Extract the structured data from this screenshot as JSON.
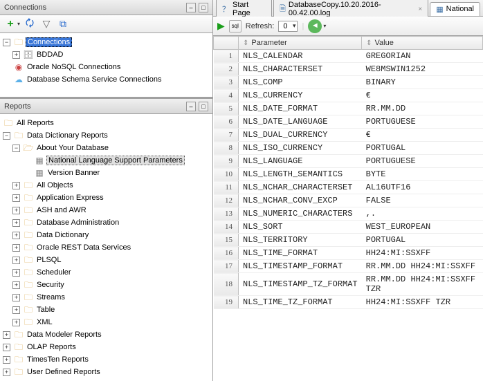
{
  "connections": {
    "title": "Connections",
    "toolbar": {
      "add": "+",
      "refresh": "↻",
      "filter": "▽",
      "layout": "⧉"
    },
    "rootLabel": "Connections",
    "items": [
      {
        "label": "BDDAD",
        "icon": "db"
      },
      {
        "label": "Oracle NoSQL Connections",
        "icon": "nosql"
      },
      {
        "label": "Database Schema Service Connections",
        "icon": "cloud"
      }
    ]
  },
  "reports": {
    "title": "Reports",
    "rootLabel": "All Reports",
    "dataDict": "Data Dictionary Reports",
    "aboutDb": "About Your Database",
    "nlsParams": "National Language Support Parameters",
    "versionBanner": "Version Banner",
    "groups": [
      "All Objects",
      "Application Express",
      "ASH and AWR",
      "Database Administration",
      "Data Dictionary",
      "Oracle REST Data Services",
      "PLSQL",
      "Scheduler",
      "Security",
      "Streams",
      "Table",
      "XML"
    ],
    "otherReports": [
      "Data Modeler Reports",
      "OLAP Reports",
      "TimesTen Reports",
      "User Defined Reports"
    ]
  },
  "tabs": {
    "start": "Start Page",
    "log": "DatabaseCopy.10.20.2016-00.42.00.log",
    "national": "National"
  },
  "toolbar2": {
    "refreshLabel": "Refresh:",
    "refreshValue": "0"
  },
  "grid": {
    "col1": "Parameter",
    "col2": "Value",
    "rows": [
      {
        "n": "1",
        "p": "NLS_CALENDAR",
        "v": "GREGORIAN"
      },
      {
        "n": "2",
        "p": "NLS_CHARACTERSET",
        "v": "WE8MSWIN1252"
      },
      {
        "n": "3",
        "p": "NLS_COMP",
        "v": "BINARY"
      },
      {
        "n": "4",
        "p": "NLS_CURRENCY",
        "v": "€"
      },
      {
        "n": "5",
        "p": "NLS_DATE_FORMAT",
        "v": "RR.MM.DD"
      },
      {
        "n": "6",
        "p": "NLS_DATE_LANGUAGE",
        "v": "PORTUGUESE"
      },
      {
        "n": "7",
        "p": "NLS_DUAL_CURRENCY",
        "v": "€"
      },
      {
        "n": "8",
        "p": "NLS_ISO_CURRENCY",
        "v": "PORTUGAL"
      },
      {
        "n": "9",
        "p": "NLS_LANGUAGE",
        "v": "PORTUGUESE"
      },
      {
        "n": "10",
        "p": "NLS_LENGTH_SEMANTICS",
        "v": "BYTE"
      },
      {
        "n": "11",
        "p": "NLS_NCHAR_CHARACTERSET",
        "v": "AL16UTF16"
      },
      {
        "n": "12",
        "p": "NLS_NCHAR_CONV_EXCP",
        "v": "FALSE"
      },
      {
        "n": "13",
        "p": "NLS_NUMERIC_CHARACTERS",
        "v": ",."
      },
      {
        "n": "14",
        "p": "NLS_SORT",
        "v": "WEST_EUROPEAN"
      },
      {
        "n": "15",
        "p": "NLS_TERRITORY",
        "v": "PORTUGAL"
      },
      {
        "n": "16",
        "p": "NLS_TIME_FORMAT",
        "v": "HH24:MI:SSXFF"
      },
      {
        "n": "17",
        "p": "NLS_TIMESTAMP_FORMAT",
        "v": "RR.MM.DD HH24:MI:SSXFF"
      },
      {
        "n": "18",
        "p": "NLS_TIMESTAMP_TZ_FORMAT",
        "v": "RR.MM.DD HH24:MI:SSXFF TZR"
      },
      {
        "n": "19",
        "p": "NLS_TIME_TZ_FORMAT",
        "v": "HH24:MI:SSXFF TZR"
      }
    ]
  }
}
